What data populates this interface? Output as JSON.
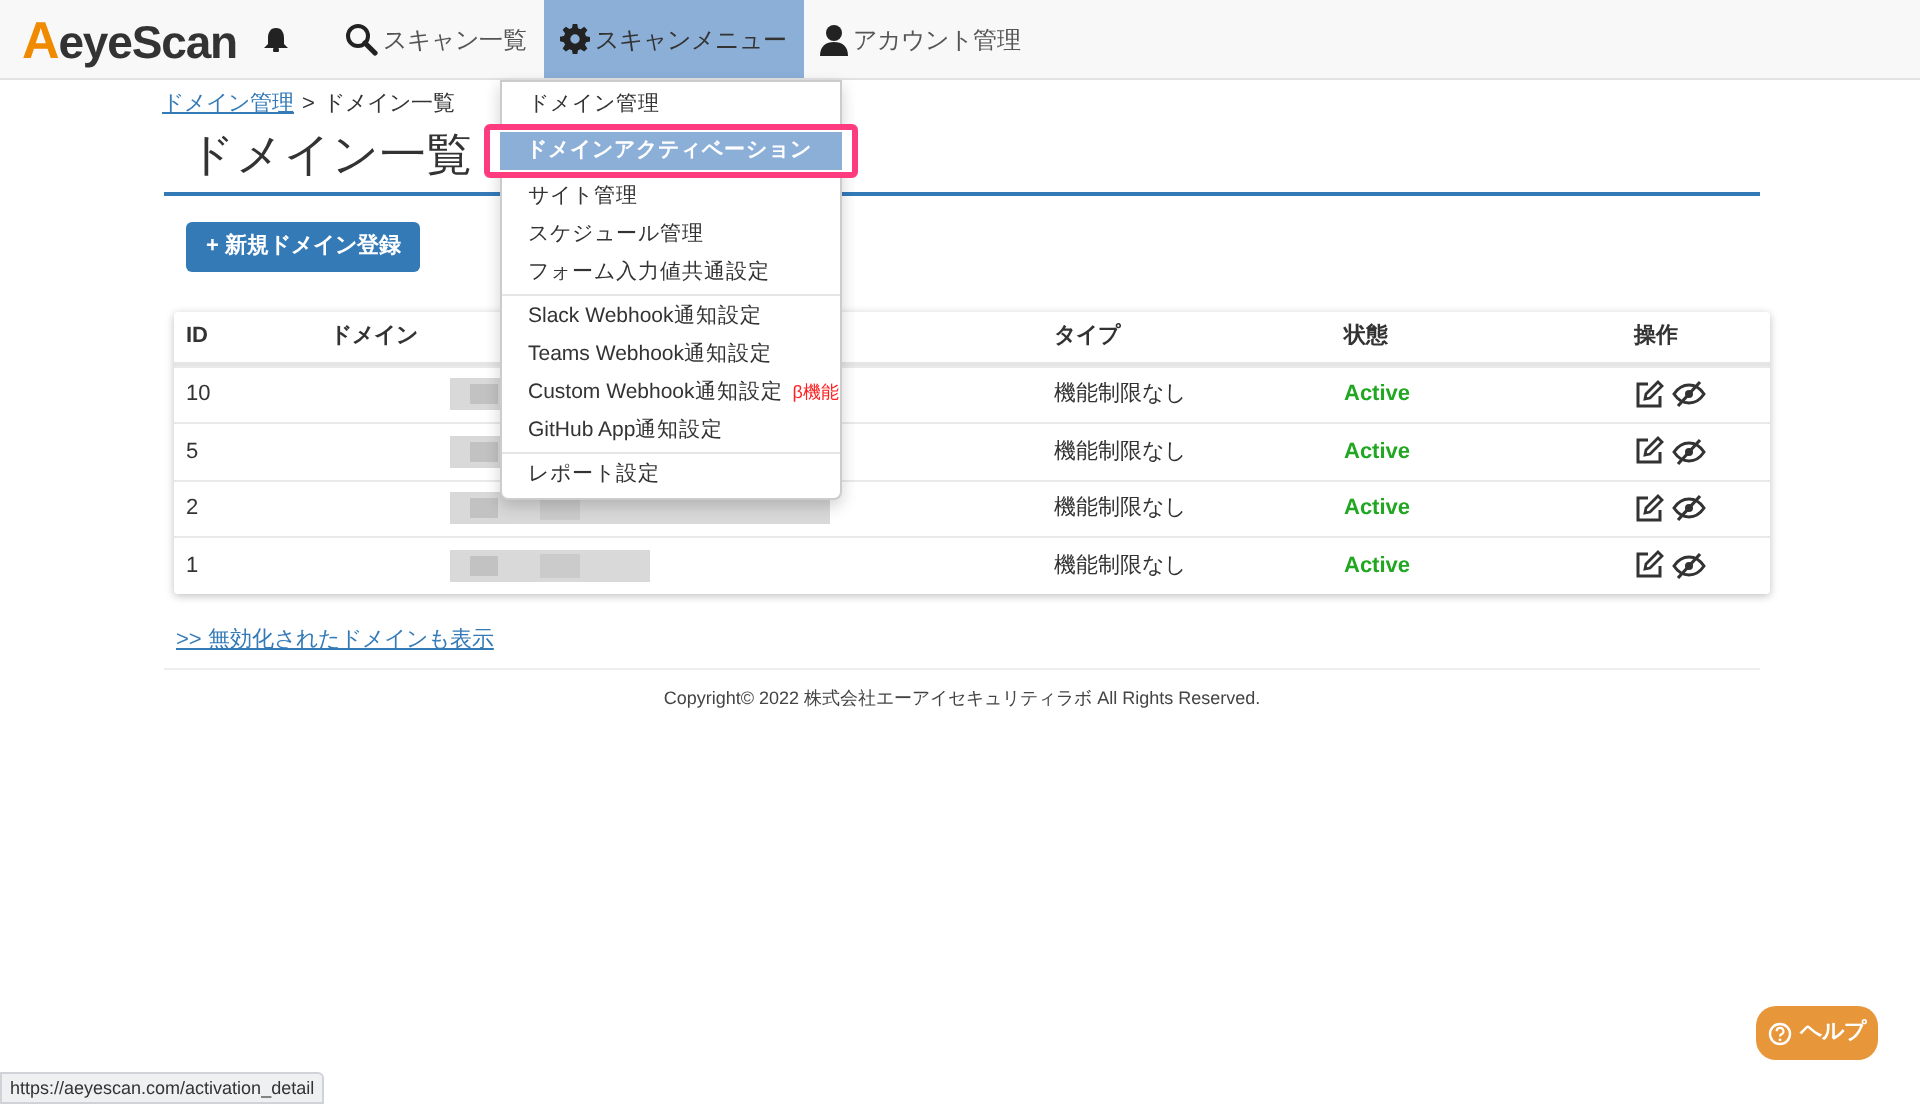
{
  "header": {
    "logo": "AeyeScan",
    "nav": [
      {
        "label": "スキャン一覧",
        "selected": false
      },
      {
        "label": "スキャンメニュー",
        "selected": true
      },
      {
        "label": "アカウント管理",
        "selected": false
      }
    ]
  },
  "dropdown": {
    "groups": [
      [
        {
          "label": "ドメイン管理",
          "selected": false
        },
        {
          "label": "ドメインアクティベーション",
          "selected": true
        },
        {
          "label": "サイト管理",
          "selected": false
        },
        {
          "label": "スケジュール管理",
          "selected": false
        },
        {
          "label": "フォーム入力値共通設定",
          "selected": false
        }
      ],
      [
        {
          "label": "Slack Webhook通知設定",
          "selected": false
        },
        {
          "label": "Teams Webhook通知設定",
          "selected": false
        },
        {
          "label": "Custom Webhook通知設定",
          "badge": "β機能",
          "selected": false
        },
        {
          "label": "GitHub App通知設定",
          "selected": false
        }
      ],
      [
        {
          "label": "レポート設定",
          "selected": false
        }
      ]
    ]
  },
  "breadcrumb": {
    "link": "ドメイン管理",
    "separator": ">",
    "current": "ドメイン一覧"
  },
  "title": "ドメイン一覧",
  "new_button": "+ 新規ドメイン登録",
  "table": {
    "columns": [
      "ID",
      "ドメイン",
      "タイプ",
      "状態",
      "操作"
    ],
    "rows": [
      {
        "id": "10",
        "type": "機能制限なし",
        "status": "Active"
      },
      {
        "id": "5",
        "type": "機能制限なし",
        "status": "Active"
      },
      {
        "id": "2",
        "type": "機能制限なし",
        "status": "Active"
      },
      {
        "id": "1",
        "type": "機能制限なし",
        "status": "Active"
      }
    ]
  },
  "show_disabled_link": ">> 無効化されたドメインも表示",
  "footer": "Copyright© 2022 株式会社エーアイセキュリティラボ All Rights Reserved.",
  "help_button": "ヘルプ",
  "status_url": "https://aeyescan.com/activation_detail"
}
